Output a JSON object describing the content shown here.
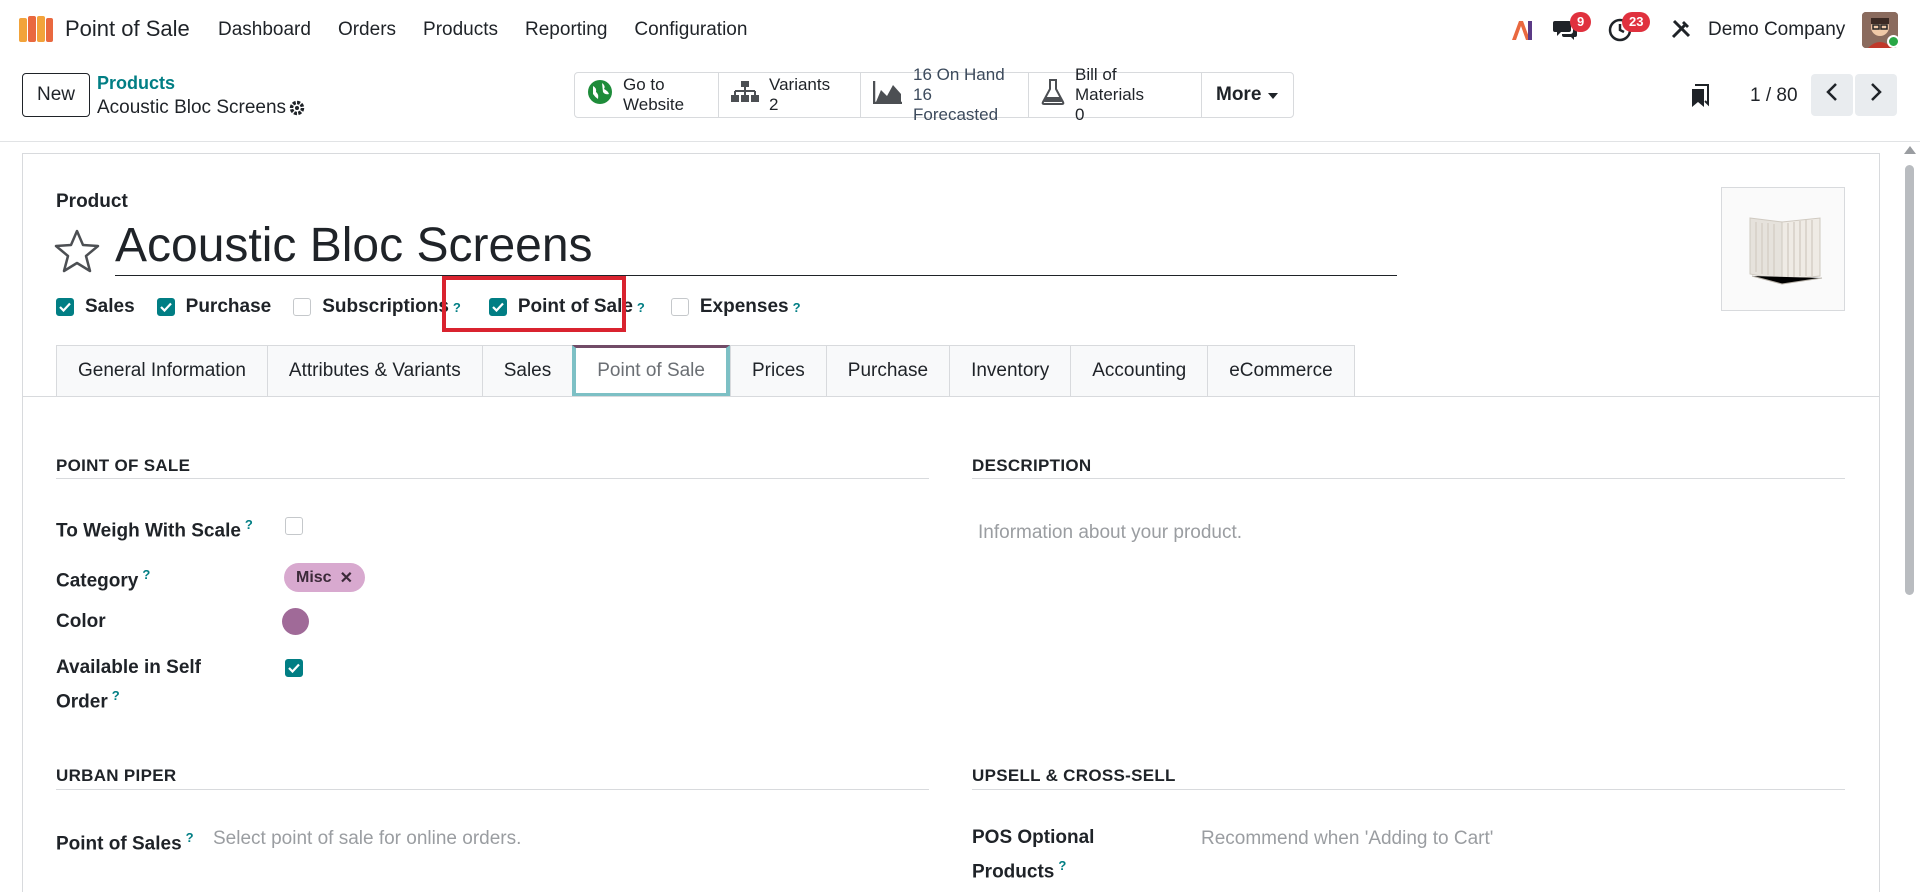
{
  "navbar": {
    "app_name": "Point of Sale",
    "menu": [
      "Dashboard",
      "Orders",
      "Products",
      "Reporting",
      "Configuration"
    ],
    "messages_badge": "9",
    "activities_badge": "23",
    "company": "Demo Company"
  },
  "control_panel": {
    "new_label": "New",
    "breadcrumb_parent": "Products",
    "breadcrumb_current": "Acoustic Bloc Screens",
    "smart_buttons": {
      "website": "Go to Website",
      "website_line1": "Go to",
      "website_line2": "Website",
      "variants_label": "Variants",
      "variants_value": "2",
      "on_hand": "16 On Hand",
      "forecasted": "16 Forecasted",
      "bom_label": "Bill of Materials",
      "bom_value": "0",
      "more": "More"
    },
    "pager": "1 / 80"
  },
  "form": {
    "product_label": "Product",
    "name": "Acoustic Bloc Screens",
    "flags": [
      {
        "label": "Sales",
        "checked": true
      },
      {
        "label": "Purchase",
        "checked": true
      },
      {
        "label": "Subscriptions",
        "checked": false
      },
      {
        "label": "Point of Sale",
        "checked": true
      },
      {
        "label": "Expenses",
        "checked": false
      }
    ],
    "tabs": [
      "General Information",
      "Attributes & Variants",
      "Sales",
      "Point of Sale",
      "Prices",
      "Purchase",
      "Inventory",
      "Accounting",
      "eCommerce"
    ],
    "active_tab": "Point of Sale",
    "pos_section": {
      "title": "POINT OF SALE",
      "to_weigh_label": "To Weigh With Scale",
      "to_weigh_checked": false,
      "category_label": "Category",
      "category_tag": "Misc",
      "color_label": "Color",
      "color_value": "#a06a98",
      "self_order_label_1": "Available in Self",
      "self_order_label_2": "Order",
      "self_order_checked": true
    },
    "description_section": {
      "title": "DESCRIPTION",
      "placeholder": "Information about your product."
    },
    "urban_piper_section": {
      "title": "URBAN PIPER",
      "pos_label": "Point of Sales",
      "pos_placeholder": "Select point of sale for online orders."
    },
    "upsell_section": {
      "title": "UPSELL & CROSS-SELL",
      "optional_label_1": "POS Optional",
      "optional_label_2": "Products",
      "optional_placeholder": "Recommend when 'Adding to Cart'"
    }
  },
  "colors": {
    "accent": "#017e84",
    "brand": "#714b67",
    "highlight": "#d9232f",
    "badge": "#e0313e"
  }
}
